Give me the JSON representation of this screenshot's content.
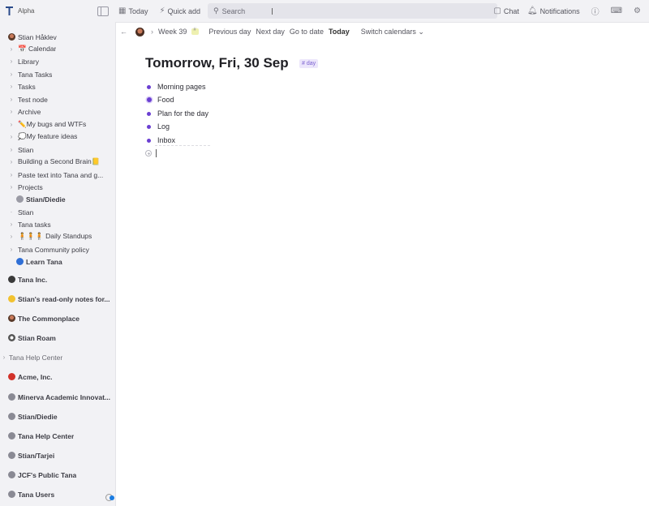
{
  "app": {
    "name": "Alpha"
  },
  "topbar": {
    "today_label": "Today",
    "quick_add_label": "Quick add",
    "search_placeholder": "Search",
    "chat_label": "Chat",
    "notifications_label": "Notifications"
  },
  "sidebar": {
    "workspace_items": [
      {
        "label": "Stian Håklev",
        "chevron": false,
        "avatar": "av-stian",
        "bold": false
      },
      {
        "label": "📅 Calendar",
        "chevron": true
      },
      {
        "label": "Library",
        "chevron": true
      },
      {
        "label": "Tana Tasks",
        "chevron": true
      },
      {
        "label": "Tasks",
        "chevron": true
      },
      {
        "label": "Test node",
        "chevron": true
      },
      {
        "label": "Archive",
        "chevron": true
      },
      {
        "label": "✏️My bugs and WTFs",
        "chevron": true
      },
      {
        "label": "💭My feature ideas",
        "chevron": true
      },
      {
        "label": "Stian",
        "chevron": true
      },
      {
        "label": "Building a Second Brain📒",
        "chevron": true
      },
      {
        "label": "Paste text into Tana and g...",
        "chevron": true
      },
      {
        "label": "Projects",
        "chevron": true
      },
      {
        "label": "Stian/Diedie",
        "chevron": false,
        "avatar": "av-diedie",
        "bold": true
      },
      {
        "label": "Stian",
        "chevron": false,
        "dot": true
      },
      {
        "label": "Tana tasks",
        "chevron": true
      },
      {
        "label": "🧍🧍🧍 Daily Standups",
        "chevron": true
      },
      {
        "label": "Tana Community policy",
        "chevron": true
      },
      {
        "label": "Learn Tana",
        "chevron": false,
        "avatar": "av-blue",
        "bold": true
      }
    ],
    "workspaces": [
      {
        "label": "Tana Inc.",
        "avatar": "av-dark"
      },
      {
        "label": "Stian's read-only notes for...",
        "avatar": "av-yellow"
      },
      {
        "label": "The Commonplace",
        "avatar": "av-stian"
      },
      {
        "label": "Stian Roam",
        "avatar": "av-ball"
      },
      {
        "label": "Tana Help Center",
        "avatar": "",
        "chevron": true,
        "light": true
      },
      {
        "label": "Acme, Inc.",
        "avatar": "av-red"
      },
      {
        "label": "Minerva Academic Innovat...",
        "avatar": "av-grey"
      },
      {
        "label": "Stian/Diedie",
        "avatar": "av-grey"
      },
      {
        "label": "Tana Help Center",
        "avatar": "av-grey"
      },
      {
        "label": "Stian/Tarjei",
        "avatar": "av-grey"
      },
      {
        "label": "JCF's Public Tana",
        "avatar": "av-grey"
      },
      {
        "label": "Tana Users",
        "avatar": "av-grey"
      }
    ]
  },
  "navbar": {
    "week_label": "Week 39",
    "previous_day": "Previous day",
    "next_day": "Next day",
    "go_to_date": "Go to date",
    "today": "Today",
    "switch_calendars": "Switch calendars"
  },
  "page": {
    "title": "Tomorrow, Fri, 30 Sep",
    "tag": "# day",
    "nodes": [
      {
        "text": "Morning pages",
        "style": "dot"
      },
      {
        "text": "Food",
        "style": "ring"
      },
      {
        "text": "Plan for the day",
        "style": "dot"
      },
      {
        "text": "Log",
        "style": "dot"
      },
      {
        "text": "Inbox",
        "style": "dot"
      }
    ]
  },
  "colors": {
    "bullet": "#6b3fd2",
    "tag_bg": "#ece6fb",
    "tag_text": "#7a5fd0",
    "accent_blue": "#1a7de3"
  }
}
